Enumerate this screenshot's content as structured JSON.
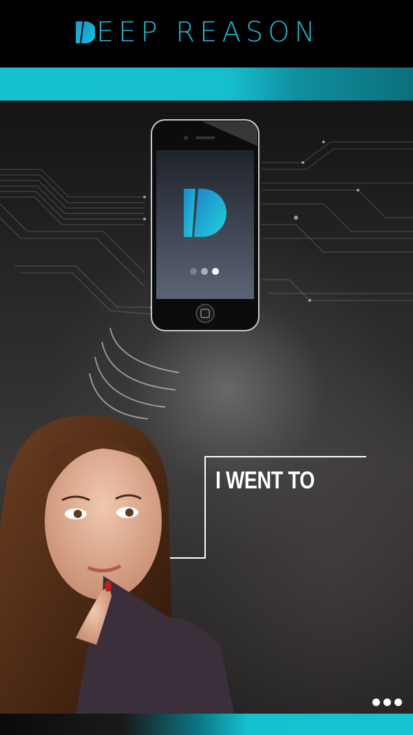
{
  "brand": {
    "wordmark_suffix": "EEP REASON",
    "logo_icon": "d-logo-icon",
    "accent_color": "#23b8cc"
  },
  "phone_screen": {
    "logo_icon": "d-logo-icon",
    "page_indicator": {
      "count": 3,
      "active_index": 2
    }
  },
  "callout": {
    "text": "I WENT TO"
  },
  "menu": {
    "icon": "more-dots-icon"
  },
  "colors": {
    "teal": "#15c1d0",
    "background": "#000000",
    "text": "#ffffff"
  }
}
